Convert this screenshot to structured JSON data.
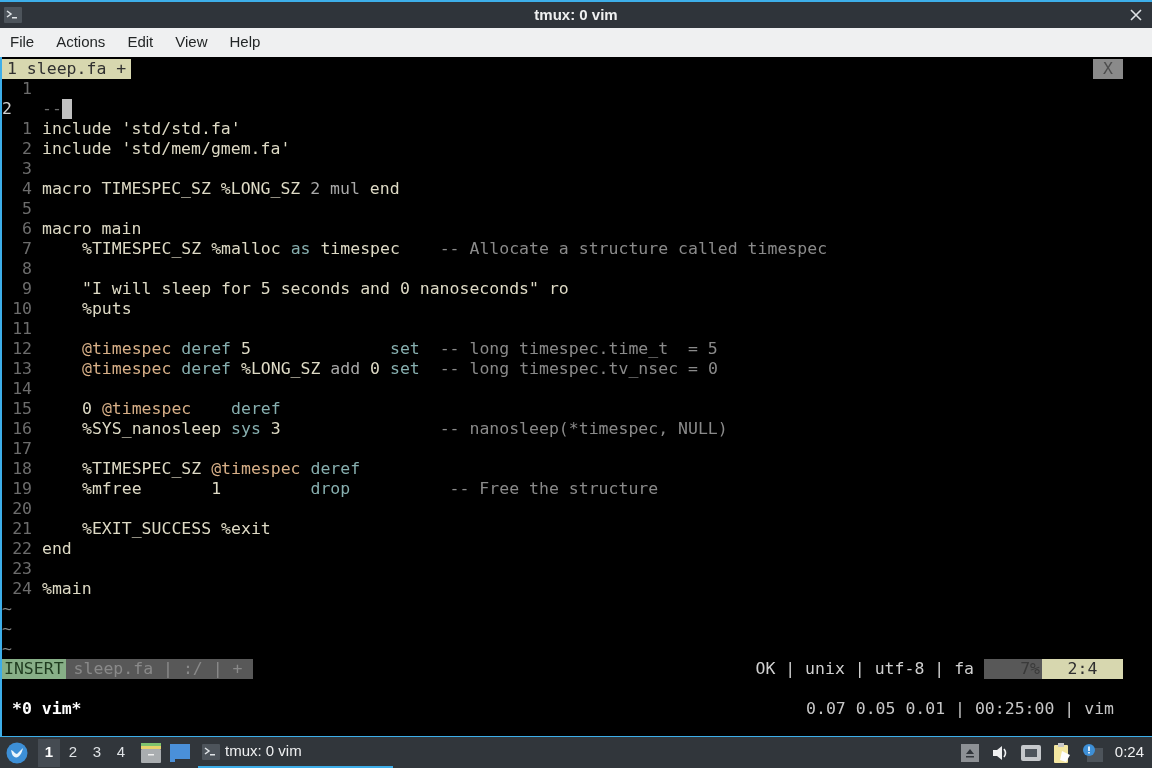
{
  "window": {
    "title": "tmux: 0 vim"
  },
  "menu": [
    "File",
    "Actions",
    "Edit",
    "View",
    "Help"
  ],
  "vim": {
    "tabs": [
      {
        "label": "1 sleep.fa +",
        "selected": true
      }
    ],
    "close_label": "X",
    "lines": [
      {
        "number": "1",
        "current": false
      },
      {
        "number": "2",
        "current": true,
        "indented": false,
        "segments": [
          {
            "kind": "dim",
            "text": "--"
          }
        ]
      },
      {
        "number": "1",
        "current": false,
        "indented": false,
        "segments": [
          {
            "kind": "plain",
            "text": "include 'std/std.fa'"
          }
        ]
      },
      {
        "number": "2",
        "current": false,
        "indented": false,
        "segments": [
          {
            "kind": "plain",
            "text": "include 'std/mem/gmem.fa'"
          }
        ]
      },
      {
        "number": "3",
        "current": false
      },
      {
        "number": "4",
        "current": false,
        "indented": false,
        "segments": [
          {
            "kind": "plain",
            "text": "macro TIMESPEC_SZ %LONG_SZ "
          },
          {
            "kind": "op",
            "text": "2 mul"
          },
          {
            "kind": "plain",
            "text": " end"
          }
        ]
      },
      {
        "number": "5",
        "current": false
      },
      {
        "number": "6",
        "current": false,
        "indented": false,
        "segments": [
          {
            "kind": "plain",
            "text": "macro main"
          }
        ]
      },
      {
        "number": "7",
        "current": false,
        "indented": true,
        "segments": [
          {
            "kind": "plain",
            "text": "%TIMESPEC_SZ %malloc "
          },
          {
            "kind": "keyword",
            "text": "as"
          },
          {
            "kind": "plain",
            "text": " timespec"
          },
          {
            "kind": "comment",
            "text": "    -- Allocate a structure called timespec"
          }
        ]
      },
      {
        "number": "8",
        "current": false
      },
      {
        "number": "9",
        "current": false,
        "indented": true,
        "segments": [
          {
            "kind": "plain",
            "text": "\"I will sleep for 5 seconds and 0 nanoseconds\" ro"
          }
        ]
      },
      {
        "number": "10",
        "current": false,
        "indented": true,
        "segments": [
          {
            "kind": "plain",
            "text": "%puts"
          }
        ]
      },
      {
        "number": "11",
        "current": false
      },
      {
        "number": "12",
        "current": false,
        "indented": true,
        "segments": [
          {
            "kind": "var",
            "text": "@timespec"
          },
          {
            "kind": "keyword",
            "text": " deref"
          },
          {
            "kind": "plain",
            "text": " 5              "
          },
          {
            "kind": "keyword",
            "text": "set"
          },
          {
            "kind": "comment",
            "text": "  -- long timespec.time_t  = 5"
          }
        ]
      },
      {
        "number": "13",
        "current": false,
        "indented": true,
        "segments": [
          {
            "kind": "var",
            "text": "@timespec"
          },
          {
            "kind": "keyword",
            "text": " deref"
          },
          {
            "kind": "plain",
            "text": " %LONG_SZ "
          },
          {
            "kind": "op",
            "text": "add"
          },
          {
            "kind": "plain",
            "text": " 0 "
          },
          {
            "kind": "keyword",
            "text": "set"
          },
          {
            "kind": "comment",
            "text": "  -- long timespec.tv_nsec = 0"
          }
        ]
      },
      {
        "number": "14",
        "current": false
      },
      {
        "number": "15",
        "current": false,
        "indented": true,
        "segments": [
          {
            "kind": "plain",
            "text": "0 "
          },
          {
            "kind": "var",
            "text": "@timespec"
          },
          {
            "kind": "keyword",
            "text": "    deref"
          }
        ]
      },
      {
        "number": "16",
        "current": false,
        "indented": true,
        "segments": [
          {
            "kind": "plain",
            "text": "%SYS_nanosleep "
          },
          {
            "kind": "keyword",
            "text": "sys"
          },
          {
            "kind": "plain",
            "text": " 3"
          },
          {
            "kind": "comment",
            "text": "                -- nanosleep(*timespec, NULL)"
          }
        ]
      },
      {
        "number": "17",
        "current": false
      },
      {
        "number": "18",
        "current": false,
        "indented": true,
        "segments": [
          {
            "kind": "plain",
            "text": "%TIMESPEC_SZ "
          },
          {
            "kind": "var",
            "text": "@timespec"
          },
          {
            "kind": "keyword",
            "text": " deref"
          }
        ]
      },
      {
        "number": "19",
        "current": false,
        "indented": true,
        "segments": [
          {
            "kind": "plain",
            "text": "%mfree       1         "
          },
          {
            "kind": "keyword",
            "text": "drop"
          },
          {
            "kind": "comment",
            "text": "          -- Free the structure"
          }
        ]
      },
      {
        "number": "20",
        "current": false
      },
      {
        "number": "21",
        "current": false,
        "indented": true,
        "segments": [
          {
            "kind": "plain",
            "text": "%EXIT_SUCCESS %exit"
          }
        ]
      },
      {
        "number": "22",
        "current": false,
        "indented": false,
        "segments": [
          {
            "kind": "plain",
            "text": "end"
          }
        ]
      },
      {
        "number": "23",
        "current": false
      },
      {
        "number": "24",
        "current": false,
        "indented": false,
        "segments": [
          {
            "kind": "plain",
            "text": "%main"
          }
        ]
      }
    ],
    "tildes": [
      "~",
      "~",
      "~"
    ],
    "statusline": {
      "mode": "INSERT",
      "file": "sleep.fa | :/ | +",
      "info": "OK | unix | utf-8 | fa",
      "percent": "7%",
      "position": "2:4"
    }
  },
  "tmux": {
    "windows": "*0 vim*",
    "status": "0.07 0.05 0.01 | 00:25:00 | vim"
  },
  "taskbar": {
    "desktops": [
      {
        "label": "1",
        "selected": true
      },
      {
        "label": "2",
        "selected": false
      },
      {
        "label": "3",
        "selected": false
      },
      {
        "label": "4",
        "selected": false
      }
    ],
    "tasks": [
      {
        "label": "tmux: 0 vim",
        "selected": true
      }
    ],
    "clock": "0:24"
  }
}
